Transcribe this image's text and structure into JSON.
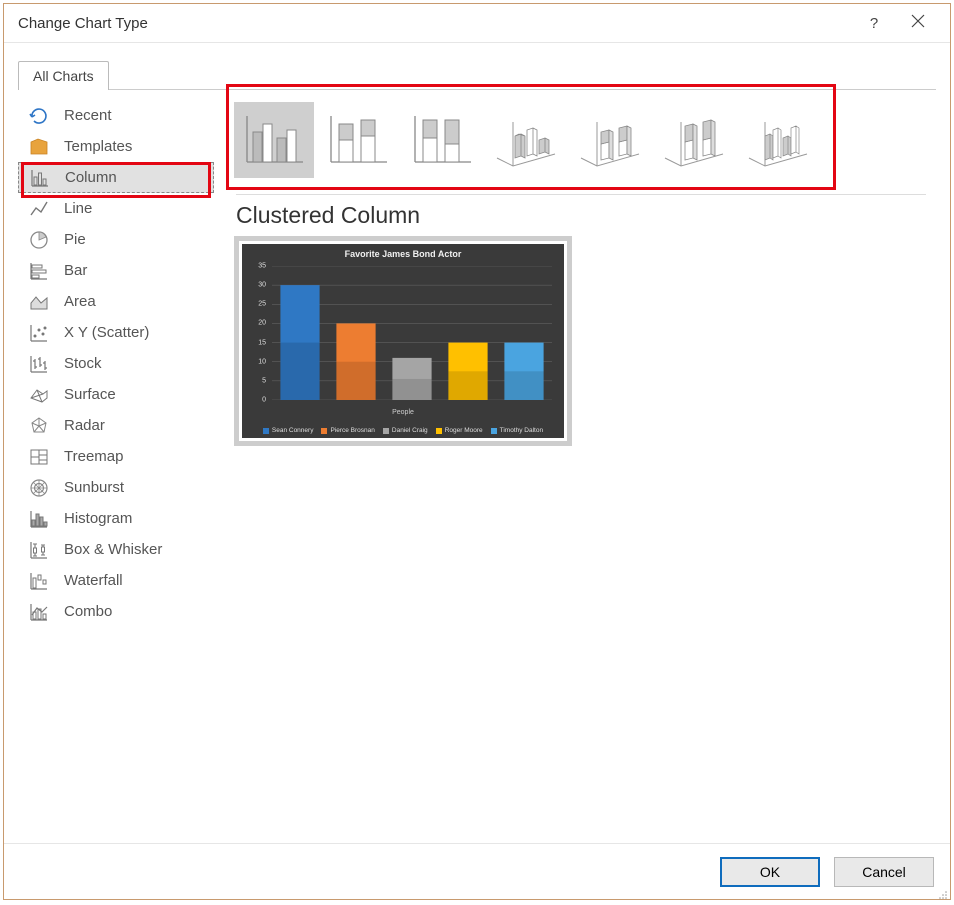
{
  "dialog": {
    "title": "Change Chart Type",
    "tab_label": "All Charts",
    "ok_label": "OK",
    "cancel_label": "Cancel"
  },
  "sidebar": {
    "items": [
      {
        "label": "Recent"
      },
      {
        "label": "Templates"
      },
      {
        "label": "Column"
      },
      {
        "label": "Line"
      },
      {
        "label": "Pie"
      },
      {
        "label": "Bar"
      },
      {
        "label": "Area"
      },
      {
        "label": "X Y (Scatter)"
      },
      {
        "label": "Stock"
      },
      {
        "label": "Surface"
      },
      {
        "label": "Radar"
      },
      {
        "label": "Treemap"
      },
      {
        "label": "Sunburst"
      },
      {
        "label": "Histogram"
      },
      {
        "label": "Box & Whisker"
      },
      {
        "label": "Waterfall"
      },
      {
        "label": "Combo"
      }
    ]
  },
  "subtype": {
    "title": "Clustered Column"
  },
  "chart_data": {
    "type": "bar",
    "title": "Favorite James Bond Actor",
    "xlabel": "People",
    "ylabel": "",
    "ylim": [
      0,
      35
    ],
    "yticks": [
      0,
      5,
      10,
      15,
      20,
      25,
      30,
      35
    ],
    "series": [
      {
        "name": "Sean Connery",
        "value": 30,
        "color": "#2f78c4"
      },
      {
        "name": "Pierce Brosnan",
        "value": 20,
        "color": "#ed7d31"
      },
      {
        "name": "Daniel Craig",
        "value": 11,
        "color": "#a5a5a5"
      },
      {
        "name": "Roger Moore",
        "value": 15,
        "color": "#ffc000"
      },
      {
        "name": "Timothy Dalton",
        "value": 15,
        "color": "#4aa4e0"
      }
    ]
  }
}
